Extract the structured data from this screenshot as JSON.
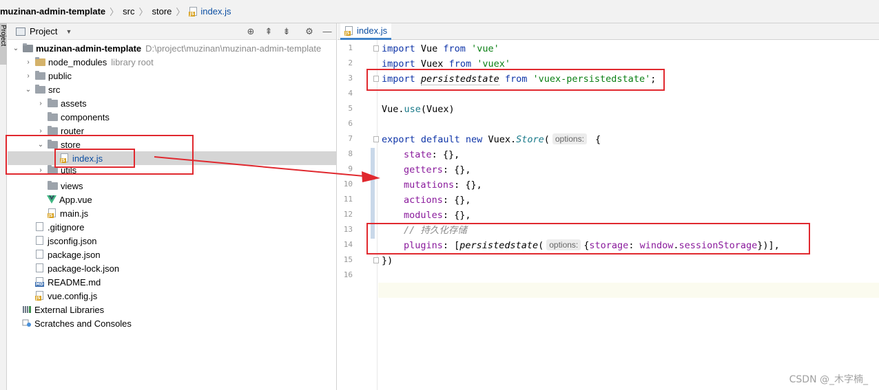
{
  "breadcrumb": {
    "items": [
      "muzinan-admin-template",
      "src",
      "store",
      "index.js"
    ],
    "file_tag": "JS"
  },
  "side_stripe": {
    "label": "Project"
  },
  "project_panel": {
    "title": "Project",
    "header_icons": [
      "crosshair-icon",
      "collapse-all-icon",
      "expand-all-icon",
      "gear-icon",
      "minimize-icon"
    ],
    "tree": [
      {
        "label": "muzinan-admin-template",
        "hint": "D:\\project\\muzinan\\muzinan-admin-template",
        "type": "folder",
        "expanded": true
      },
      {
        "label": "node_modules",
        "hint": "library root",
        "type": "folder",
        "expanded": false
      },
      {
        "label": "public",
        "type": "folder",
        "expanded": false
      },
      {
        "label": "src",
        "type": "folder",
        "expanded": true
      },
      {
        "label": "assets",
        "type": "folder",
        "expanded": false
      },
      {
        "label": "components",
        "type": "folder"
      },
      {
        "label": "router",
        "type": "folder",
        "expanded": false
      },
      {
        "label": "store",
        "type": "folder",
        "expanded": true
      },
      {
        "label": "index.js",
        "type": "js",
        "selected": true
      },
      {
        "label": "utils",
        "type": "folder",
        "expanded": false
      },
      {
        "label": "views",
        "type": "folder"
      },
      {
        "label": "App.vue",
        "type": "vue"
      },
      {
        "label": "main.js",
        "type": "js"
      },
      {
        "label": ".gitignore",
        "type": "text"
      },
      {
        "label": "jsconfig.json",
        "type": "json"
      },
      {
        "label": "package.json",
        "type": "json"
      },
      {
        "label": "package-lock.json",
        "type": "json"
      },
      {
        "label": "README.md",
        "type": "md"
      },
      {
        "label": "vue.config.js",
        "type": "js"
      },
      {
        "label": "External Libraries",
        "type": "library"
      },
      {
        "label": "Scratches and Consoles",
        "type": "scratch"
      }
    ]
  },
  "editor": {
    "tab_label": "index.js",
    "line_numbers": [
      "1",
      "2",
      "3",
      "4",
      "5",
      "6",
      "7",
      "8",
      "9",
      "10",
      "11",
      "12",
      "13",
      "14",
      "15",
      "16"
    ],
    "code": {
      "l1": {
        "kw1": "import",
        "id": " Vue ",
        "kw2": "from",
        "str": " 'vue'"
      },
      "l2": {
        "kw1": "import",
        "id": " Vuex ",
        "kw2": "from",
        "str": " 'vuex'"
      },
      "l3": {
        "kw1": "import",
        "id": "persistedstate",
        "kw2": "from",
        "str": "'vuex-persistedstate'",
        "end": ";"
      },
      "l5": {
        "obj": "Vue",
        "dot": ".",
        "method": "use",
        "args": "(Vuex)"
      },
      "l7": {
        "kw1": "export default new",
        "obj": " Vuex.",
        "cls": "Store",
        "open": "(",
        "hint": "options:",
        "brace": " {"
      },
      "l8": {
        "prop": "state",
        "rest": ": {},"
      },
      "l9": {
        "prop": "getters",
        "rest": ": {},"
      },
      "l10": {
        "prop": "mutations",
        "rest": ": {},"
      },
      "l11": {
        "prop": "actions",
        "rest": ": {},"
      },
      "l12": {
        "prop": "modules",
        "rest": ": {},"
      },
      "l13": {
        "comment": "// 持久化存储"
      },
      "l14": {
        "prop": "plugins",
        "rest1": ": [",
        "fn": "persistedstate",
        "open": "(",
        "hint": "options:",
        "obj_open": "{",
        "key": "storage",
        "colon": ": ",
        "win": "window",
        "dot": ".",
        "ss": "sessionStorage",
        "close": "})],"
      },
      "l15": {
        "text": "})"
      }
    }
  },
  "watermark": "CSDN @_木字楠_",
  "colors": {
    "keyword": "#0f35a8",
    "string": "#0a7f13",
    "property": "#8a1a9c",
    "comment": "#8c8c8c",
    "annotation": "#e0282e",
    "selection": "#d5d5d5"
  }
}
